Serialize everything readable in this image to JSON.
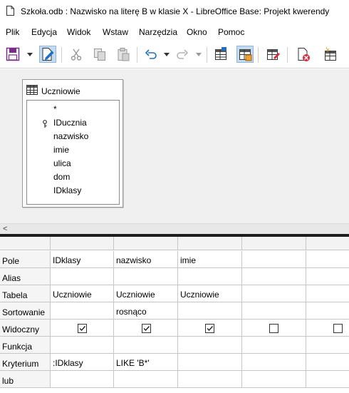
{
  "window": {
    "title": "Szkoła.odb : Nazwisko na literę B w klasie X - LibreOffice Base: Projekt kwerendy"
  },
  "menu": [
    "Plik",
    "Edycja",
    "Widok",
    "Wstaw",
    "Narzędzia",
    "Okno",
    "Pomoc"
  ],
  "toolbar": {
    "buttons": [
      "save-icon",
      "edit-mode-icon",
      "cut-icon",
      "copy-icon",
      "paste-icon",
      "undo-icon",
      "redo-icon",
      "add-table-icon",
      "design-view-icon",
      "run-query-icon",
      "clear-query-icon",
      "new-table-icon"
    ],
    "accent": "#1f6fc5",
    "active_bg": "#c4dbf0"
  },
  "table_window": {
    "title": "Uczniowie",
    "fields": [
      "*",
      "IDucznia",
      "nazwisko",
      "imie",
      "ulica",
      "dom",
      "IDklasy"
    ],
    "primary_key": "IDucznia"
  },
  "grid": {
    "row_labels": [
      "Pole",
      "Alias",
      "Tabela",
      "Sortowanie",
      "Widoczny",
      "Funkcja",
      "Kryterium",
      "lub"
    ],
    "columns": [
      {
        "pole": "IDklasy",
        "alias": "",
        "tabela": "Uczniowie",
        "sortowanie": "",
        "widoczny": true,
        "funkcja": "",
        "kryterium": ":IDklasy",
        "lub": ""
      },
      {
        "pole": "nazwisko",
        "alias": "",
        "tabela": "Uczniowie",
        "sortowanie": "rosnąco",
        "widoczny": true,
        "funkcja": "",
        "kryterium": "LIKE 'B*'",
        "lub": ""
      },
      {
        "pole": "imie",
        "alias": "",
        "tabela": "Uczniowie",
        "sortowanie": "",
        "widoczny": true,
        "funkcja": "",
        "kryterium": "",
        "lub": ""
      },
      {
        "pole": "",
        "alias": "",
        "tabela": "",
        "sortowanie": "",
        "widoczny": false,
        "funkcja": "",
        "kryterium": "",
        "lub": ""
      },
      {
        "pole": "",
        "alias": "",
        "tabela": "",
        "sortowanie": "",
        "widoczny": false,
        "funkcja": "",
        "kryterium": "",
        "lub": ""
      }
    ]
  },
  "scrollbar": {
    "left_arrow": "<"
  }
}
